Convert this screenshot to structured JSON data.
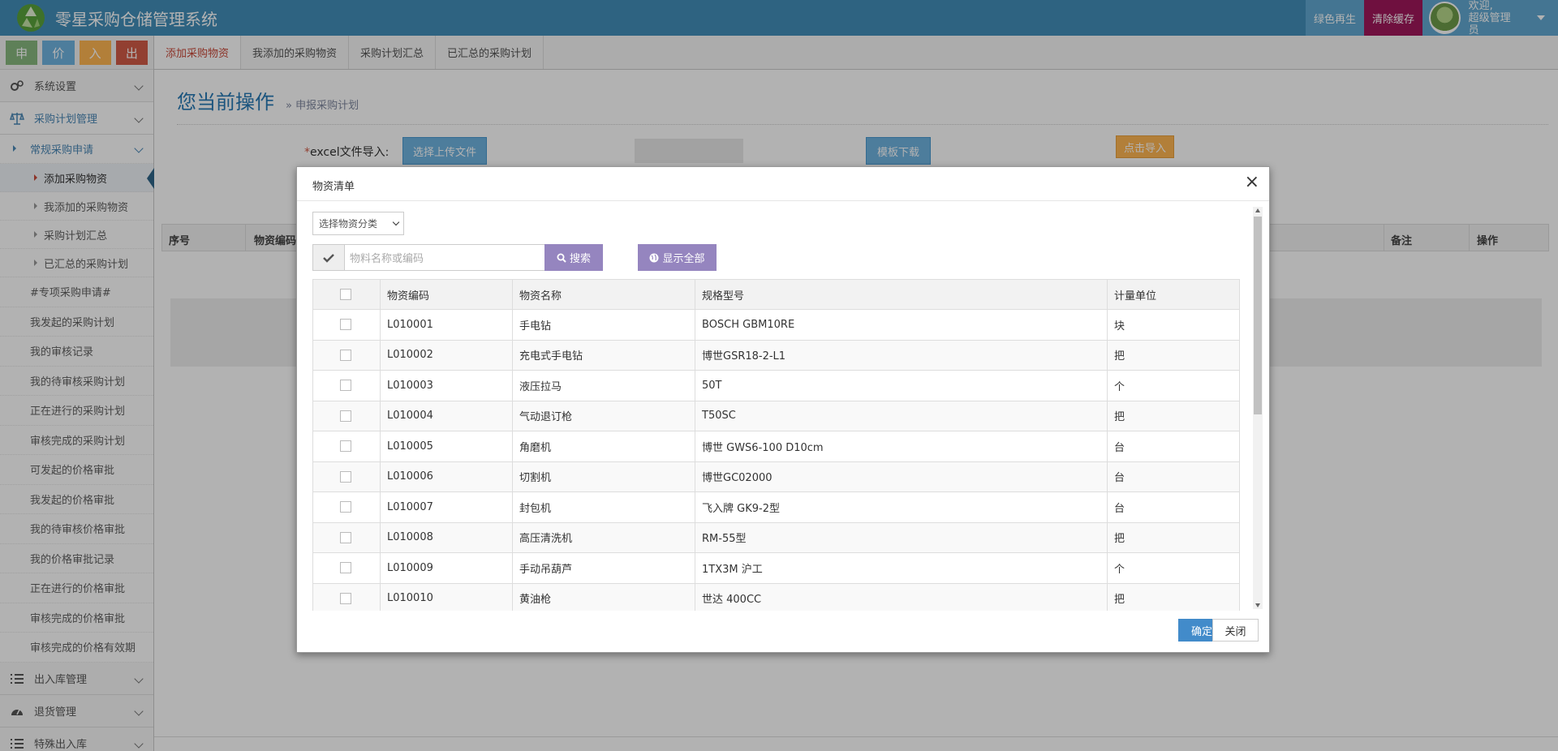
{
  "app": {
    "title": "零星采购仓储管理系统",
    "btn_green": "绿色再生",
    "btn_clear": "清除缓存",
    "welcome": "欢迎,",
    "username": "超级管理员"
  },
  "shortcuts": [
    "申",
    "价",
    "入",
    "出"
  ],
  "sidebar": {
    "system": "系统设置",
    "purchase_plan": "采购计划管理",
    "regular": "常规采购申请",
    "regular_children": [
      "添加采购物资",
      "我添加的采购物资",
      "采购计划汇总",
      "已汇总的采购计划"
    ],
    "plain_items": [
      "#专项采购申请#",
      "我发起的采购计划",
      "我的审核记录",
      "我的待审核采购计划",
      "正在进行的采购计划",
      "审核完成的采购计划",
      "可发起的价格审批",
      "我发起的价格审批",
      "我的待审核价格审批",
      "我的价格审批记录",
      "正在进行的价格审批",
      "审核完成的价格审批",
      "审核完成的价格有效期"
    ],
    "inout": "出入库管理",
    "returns": "退货管理",
    "special": "特殊出入库"
  },
  "tabs": [
    "添加采购物资",
    "我添加的采购物资",
    "采购计划汇总",
    "已汇总的采购计划"
  ],
  "page": {
    "title": "您当前操作",
    "crumb": "» 申报采购计划",
    "required_mark": "*",
    "import_label": "excel文件导入:",
    "choose_file": "选择上传文件",
    "template_download": "模板下载",
    "click_import": "点击导入",
    "bg_headers": [
      "序号",
      "物资编码",
      "备注",
      "操作"
    ]
  },
  "modal": {
    "title": "物资清单",
    "close_glyph": "×",
    "category_select": "选择物资分类",
    "search_placeholder": "物料名称或编码",
    "search_btn": "搜索",
    "show_all_btn": "显示全部",
    "headers": [
      "物资编码",
      "物资名称",
      "规格型号",
      "计量单位"
    ],
    "rows": [
      {
        "code": "L010001",
        "name": "手电钻",
        "spec": "BOSCH GBM10RE",
        "unit": "块"
      },
      {
        "code": "L010002",
        "name": "充电式手电钻",
        "spec": "博世GSR18-2-L1",
        "unit": "把"
      },
      {
        "code": "L010003",
        "name": "液压拉马",
        "spec": "50T",
        "unit": "个"
      },
      {
        "code": "L010004",
        "name": "气动退订枪",
        "spec": "T50SC",
        "unit": "把"
      },
      {
        "code": "L010005",
        "name": "角磨机",
        "spec": "博世 GWS6-100 D10cm",
        "unit": "台"
      },
      {
        "code": "L010006",
        "name": "切割机",
        "spec": "博世GC02000",
        "unit": "台"
      },
      {
        "code": "L010007",
        "name": "封包机",
        "spec": "飞入牌 GK9-2型",
        "unit": "台"
      },
      {
        "code": "L010008",
        "name": "高压清洗机",
        "spec": "RM-55型",
        "unit": "把"
      },
      {
        "code": "L010009",
        "name": "手动吊葫芦",
        "spec": "1TX3M 沪工",
        "unit": "个"
      },
      {
        "code": "L010010",
        "name": "黄油枪",
        "spec": "世达 400CC",
        "unit": "把"
      }
    ],
    "ok": "确定",
    "close": "关闭"
  }
}
